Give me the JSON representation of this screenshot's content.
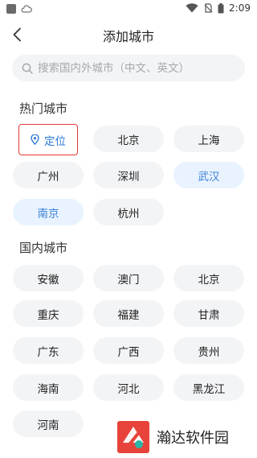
{
  "status_bar": {
    "time": "2:09"
  },
  "header": {
    "title": "添加城市"
  },
  "search": {
    "placeholder": "搜索国内外城市（中文、英文）"
  },
  "hot_cities": {
    "title": "热门城市",
    "items": [
      {
        "label": "定位"
      },
      {
        "label": "北京"
      },
      {
        "label": "上海"
      },
      {
        "label": "广州"
      },
      {
        "label": "深圳"
      },
      {
        "label": "武汉"
      },
      {
        "label": "南京"
      },
      {
        "label": "杭州"
      }
    ]
  },
  "domestic_cities": {
    "title": "国内城市",
    "items": [
      {
        "label": "安徽"
      },
      {
        "label": "澳门"
      },
      {
        "label": "北京"
      },
      {
        "label": "重庆"
      },
      {
        "label": "福建"
      },
      {
        "label": "甘肃"
      },
      {
        "label": "广东"
      },
      {
        "label": "广西"
      },
      {
        "label": "贵州"
      },
      {
        "label": "海南"
      },
      {
        "label": "河北"
      },
      {
        "label": "黑龙江"
      },
      {
        "label": "河南"
      }
    ]
  },
  "watermark": {
    "text": "瀚达软件园"
  },
  "colors": {
    "accent": "#2f7bd9",
    "highlight_bg": "#e9f3ff",
    "chip_bg": "#f3f4f6",
    "locate_border": "#e53935"
  }
}
